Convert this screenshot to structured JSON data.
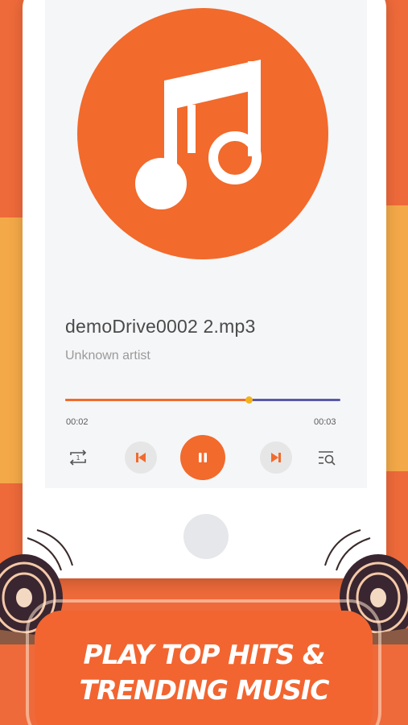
{
  "player": {
    "track_title": "demoDrive0002 2.mp3",
    "artist": "Unknown artist",
    "elapsed": "00:02",
    "total": "00:03",
    "progress_fraction": 0.666
  },
  "controls": {
    "repeat_badge": "1"
  },
  "banner": {
    "line1": "PLAY TOP HITS &",
    "line2": "TRENDING MUSIC"
  },
  "colors": {
    "accent": "#f26a2c",
    "progress_remaining": "#5a5aa8",
    "progress_knob": "#f2b21c",
    "background": "#f2572b",
    "stripe_yellow": "#f4a948"
  },
  "icons": [
    "music-note-icon",
    "repeat-one-icon",
    "previous-icon",
    "pause-icon",
    "next-icon",
    "queue-search-icon",
    "speaker-icon"
  ]
}
